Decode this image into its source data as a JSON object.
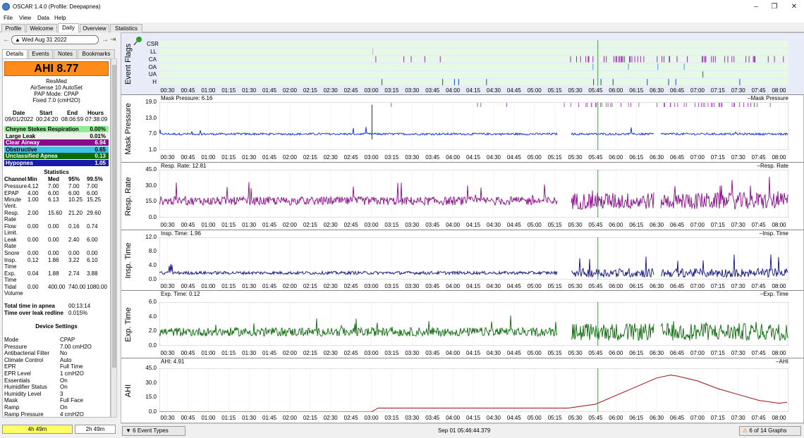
{
  "window": {
    "title": "OSCAR 1.4.0 (Profile: Deepapnea)"
  },
  "menu": [
    "File",
    "View",
    "Data",
    "Help"
  ],
  "main_tabs": [
    "Profile",
    "Welcome",
    "Daily",
    "Overview",
    "Statistics"
  ],
  "date": {
    "label": "Wed Aug 31 2022"
  },
  "sub_tabs": [
    "Details",
    "Events",
    "Notes",
    "Bookmarks"
  ],
  "summary": {
    "ahi": "AHI 8.77",
    "brand": "ResMed",
    "device": "AirSense 10 AutoSet",
    "pap_mode": "PAP Mode: CPAP",
    "fixed": "Fixed 7.0 (cmH2O)"
  },
  "session": {
    "headers": [
      "Date",
      "Start",
      "End",
      "Hours"
    ],
    "values": [
      "09/01/2022",
      "00:24:20",
      "08:06:59",
      "07:38:09"
    ]
  },
  "event_summary": [
    {
      "label": "Cheyne Stokes Respiration",
      "value": "0.00%",
      "bg": "#90ee90",
      "fg": "#000000"
    },
    {
      "label": "Large Leak",
      "value": "0.01%",
      "bg": "#f0f0f0",
      "fg": "#000000"
    },
    {
      "label": "Clear Airway",
      "value": "6.94",
      "bg": "#8b0a8b",
      "fg": "#ffffff"
    },
    {
      "label": "Obstructive",
      "value": "0.65",
      "bg": "#40c0e8",
      "fg": "#000000"
    },
    {
      "label": "Unclassified Apnea",
      "value": "0.13",
      "bg": "#0a6a0a",
      "fg": "#ffffff"
    },
    {
      "label": "Hypopnea",
      "value": "1.05",
      "bg": "#1a1aaa",
      "fg": "#ffffff"
    }
  ],
  "statistics": {
    "title": "Statistics",
    "headers": [
      "Channel",
      "Min",
      "Med",
      "95%",
      "99.5%"
    ],
    "rows": [
      {
        "name": "Pressure",
        "min": "4.12",
        "med": "7.00",
        "p95": "7.00",
        "p995": "7.00"
      },
      {
        "name": "EPAP",
        "min": "4.00",
        "med": "6.00",
        "p95": "6.00",
        "p995": "6.00"
      },
      {
        "name": "Minute Vent.",
        "min": "1.00",
        "med": "6.13",
        "p95": "10.25",
        "p995": "15.25"
      },
      {
        "name": "Resp. Rate",
        "min": "2.00",
        "med": "15.60",
        "p95": "21.20",
        "p995": "29.60"
      },
      {
        "name": "Flow Limit.",
        "min": "0.00",
        "med": "0.00",
        "p95": "0.16",
        "p995": "0.74"
      },
      {
        "name": "Leak Rate",
        "min": "0.00",
        "med": "0.00",
        "p95": "2.40",
        "p995": "6.00"
      },
      {
        "name": "Snore",
        "min": "0.00",
        "med": "0.00",
        "p95": "0.00",
        "p995": "0.00"
      },
      {
        "name": "Insp. Time",
        "min": "0.12",
        "med": "1.86",
        "p95": "3.22",
        "p995": "6.10"
      },
      {
        "name": "Exp. Time",
        "min": "0.04",
        "med": "1.88",
        "p95": "2.74",
        "p995": "3.88"
      },
      {
        "name": "Tidal Volume",
        "min": "0.00",
        "med": "400.00",
        "p95": "740.00",
        "p995": "1080.00"
      }
    ]
  },
  "totals": [
    {
      "label": "Total time in apnea",
      "value": "00:13:14"
    },
    {
      "label": "Time over leak redline",
      "value": "0.015%"
    }
  ],
  "device_settings": {
    "title": "Device Settings",
    "rows": [
      {
        "k": "Mode",
        "v": "CPAP"
      },
      {
        "k": "Pressure",
        "v": "7.00 cmH2O"
      },
      {
        "k": "Antibacterial Filter",
        "v": "No"
      },
      {
        "k": "Climate Control",
        "v": "Auto"
      },
      {
        "k": "EPR",
        "v": "Full Time"
      },
      {
        "k": "EPR Level",
        "v": "1 cmH2O"
      },
      {
        "k": "Essentials",
        "v": "On"
      },
      {
        "k": "Humidifier Status",
        "v": "On"
      },
      {
        "k": "Humidity Level",
        "v": "3"
      },
      {
        "k": "Mask",
        "v": "Full Face"
      },
      {
        "k": "Ramp",
        "v": "On"
      },
      {
        "k": "Ramp Pressure",
        "v": "4 cmH2O"
      },
      {
        "k": "Ramp Time",
        "v": "5.00 Minutes"
      }
    ]
  },
  "durations": {
    "left": "4h 49m",
    "right": "2h 49m"
  },
  "bottom": {
    "event_types": "6 Event Types",
    "cursor_time": "Sep 01 05:46:44.379",
    "graph_count": "6 of 14 Graphs"
  },
  "colors": {
    "pressure": "#0a28e0",
    "resp_rate": "#8a0a8a",
    "insp_time": "#101080",
    "exp_time": "#0a6a0a",
    "ahi": "#a01010",
    "cursor": "#00cc00",
    "flag_bg": "#e6f8e6"
  },
  "x_ticks": [
    "00:30",
    "00:45",
    "01:00",
    "01:15",
    "01:30",
    "01:45",
    "02:00",
    "02:15",
    "02:30",
    "02:45",
    "03:00",
    "03:15",
    "03:30",
    "03:45",
    "04:00",
    "04:15",
    "04:30",
    "04:45",
    "05:00",
    "05:15",
    "05:30",
    "05:45",
    "06:00",
    "06:15",
    "06:30",
    "06:45",
    "07:00",
    "07:15",
    "07:30",
    "07:45",
    "08:00"
  ],
  "charts": {
    "event_flags": {
      "ylabel": "Event Flags",
      "labels": [
        "CSR",
        "LL",
        "CA",
        "OA",
        "UA",
        "H"
      ]
    },
    "mask_pressure": {
      "ylabel": "Mask Pressure",
      "name": "Mask Pressure: 6.16",
      "legend": "Mask Pressure",
      "yticks": [
        "19.0",
        "13.0",
        "7.0",
        "1.0"
      ]
    },
    "resp_rate": {
      "ylabel": "Resp. Rate",
      "name": "Resp. Rate: 12.81",
      "legend": "Resp. Rate",
      "yticks": [
        "45.0",
        "30.0",
        "15.0",
        "0.0"
      ]
    },
    "insp_time": {
      "ylabel": "Insp. Time",
      "name": "Insp. Time: 1.96",
      "legend": "Insp. Time",
      "yticks": [
        "12.0",
        "8.0",
        "4.0",
        "0.0"
      ]
    },
    "exp_time": {
      "ylabel": "Exp. Time",
      "name": "Exp. Time: 0.12",
      "legend": "Exp. Time",
      "yticks": [
        "6.0",
        "4.0",
        "2.0",
        "0.0"
      ]
    },
    "ahi": {
      "ylabel": "AHI",
      "name": "AHI: 4.91",
      "legend": "AHI",
      "yticks": [
        "45.0",
        "30.0",
        "15.0",
        "0.0"
      ]
    }
  },
  "chart_data": [
    {
      "type": "line",
      "title": "Mask Pressure: 6.16",
      "ylim": [
        1,
        19
      ],
      "xlim": [
        "00:24",
        "08:07"
      ],
      "series": [
        {
          "name": "Mask Pressure",
          "typical_value": 7.0
        }
      ]
    },
    {
      "type": "line",
      "title": "Resp. Rate: 12.81",
      "ylim": [
        0,
        45
      ],
      "series": [
        {
          "name": "Resp. Rate",
          "typical_value": 15.6
        }
      ]
    },
    {
      "type": "line",
      "title": "Insp. Time: 1.96",
      "ylim": [
        0,
        12
      ],
      "series": [
        {
          "name": "Insp. Time",
          "typical_value": 1.86
        }
      ]
    },
    {
      "type": "line",
      "title": "Exp. Time: 0.12",
      "ylim": [
        0,
        6
      ],
      "series": [
        {
          "name": "Exp. Time",
          "typical_value": 1.88
        }
      ]
    },
    {
      "type": "line",
      "title": "AHI: 4.91",
      "ylim": [
        0,
        45
      ],
      "series": [
        {
          "name": "AHI",
          "x": [
            "00:24",
            "03:00",
            "03:05",
            "04:30",
            "04:40",
            "05:25",
            "05:45",
            "06:00",
            "06:15",
            "06:30",
            "06:40",
            "06:45",
            "07:00",
            "07:15",
            "07:30",
            "07:45",
            "08:00",
            "08:06"
          ],
          "y": [
            0,
            0,
            4,
            4,
            4,
            4,
            8,
            17,
            26,
            35,
            38,
            37,
            32,
            24,
            18,
            12,
            9,
            10
          ]
        }
      ]
    }
  ]
}
